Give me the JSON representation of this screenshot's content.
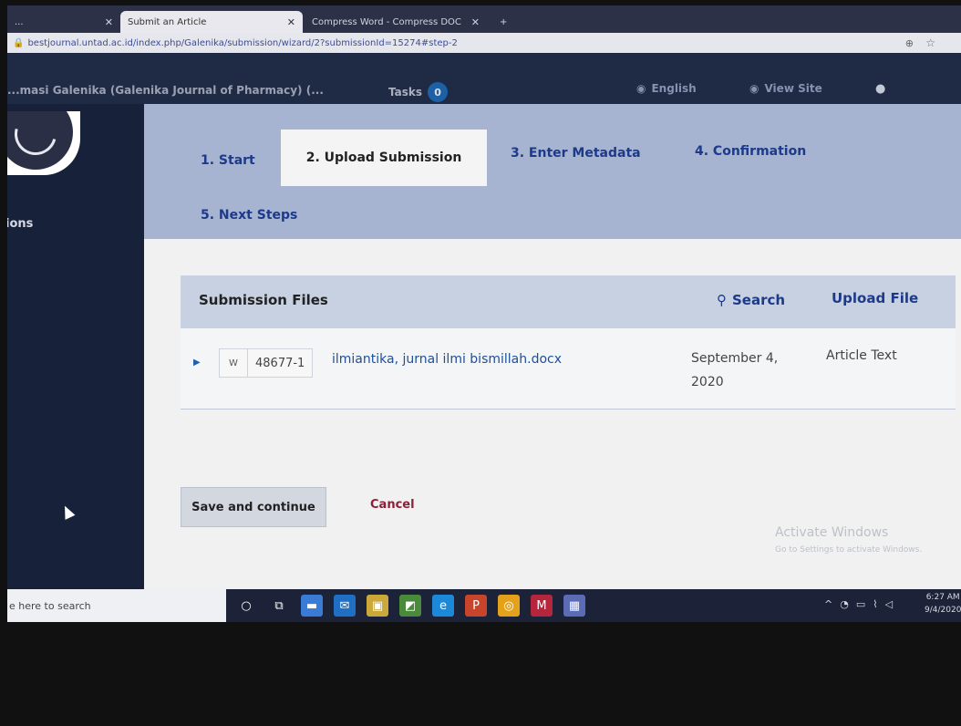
{
  "browser": {
    "tabs": [
      {
        "label": "...",
        "active": false
      },
      {
        "label": "Submit an Article",
        "active": true
      },
      {
        "label": "Compress Word - Compress DOC",
        "active": false
      }
    ],
    "url": "bestjournal.untad.ac.id/index.php/Galenika/submission/wizard/2?submissionId=15274#step-2"
  },
  "header": {
    "journal": "...masi Galenika (Galenika Journal of Pharmacy) (...",
    "tasks_label": "Tasks",
    "tasks_count": "0",
    "language": "English",
    "view_site": "View Site"
  },
  "sidebar": {
    "item": "ions"
  },
  "wizard": {
    "steps": [
      "1. Start",
      "2. Upload Submission",
      "3. Enter Metadata",
      "4. Confirmation",
      "5. Next Steps"
    ],
    "active_index": 1
  },
  "files_panel": {
    "title": "Submission Files",
    "search_label": "Search",
    "upload_label": "Upload File",
    "row": {
      "id": "48677-1",
      "name": "ilmiantika, jurnal ilmi bismillah.docx",
      "date": "September 4, 2020",
      "type": "Article Text"
    }
  },
  "actions": {
    "save": "Save and continue",
    "cancel": "Cancel"
  },
  "watermark": {
    "title": "Activate Windows",
    "subtitle": "Go to Settings to activate Windows."
  },
  "taskbar": {
    "search_placeholder": "e here to search",
    "time": "6:27 AM",
    "date": "9/4/2020"
  },
  "colors": {
    "accent": "#1d3a8a",
    "header": "#1f2b45",
    "wizard_bg": "#a6b4d2",
    "cancel": "#8a1f3a"
  }
}
